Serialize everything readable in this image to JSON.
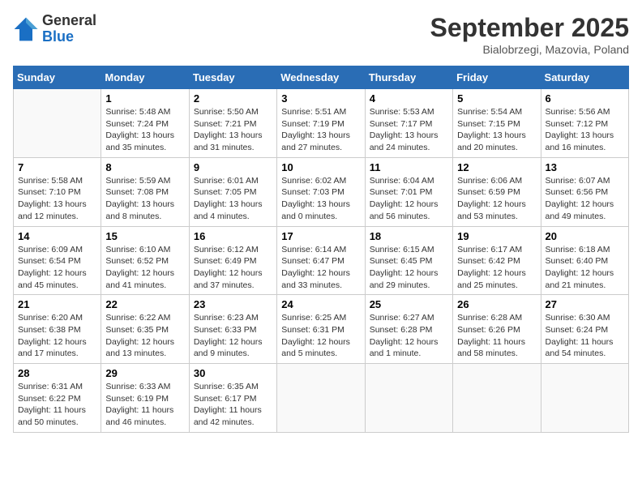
{
  "header": {
    "logo_general": "General",
    "logo_blue": "Blue",
    "month": "September 2025",
    "location": "Bialobrzegi, Mazovia, Poland"
  },
  "weekdays": [
    "Sunday",
    "Monday",
    "Tuesday",
    "Wednesday",
    "Thursday",
    "Friday",
    "Saturday"
  ],
  "weeks": [
    [
      {
        "day": null
      },
      {
        "day": 1,
        "sunrise": "5:48 AM",
        "sunset": "7:24 PM",
        "daylight": "13 hours and 35 minutes."
      },
      {
        "day": 2,
        "sunrise": "5:50 AM",
        "sunset": "7:21 PM",
        "daylight": "13 hours and 31 minutes."
      },
      {
        "day": 3,
        "sunrise": "5:51 AM",
        "sunset": "7:19 PM",
        "daylight": "13 hours and 27 minutes."
      },
      {
        "day": 4,
        "sunrise": "5:53 AM",
        "sunset": "7:17 PM",
        "daylight": "13 hours and 24 minutes."
      },
      {
        "day": 5,
        "sunrise": "5:54 AM",
        "sunset": "7:15 PM",
        "daylight": "13 hours and 20 minutes."
      },
      {
        "day": 6,
        "sunrise": "5:56 AM",
        "sunset": "7:12 PM",
        "daylight": "13 hours and 16 minutes."
      }
    ],
    [
      {
        "day": 7,
        "sunrise": "5:58 AM",
        "sunset": "7:10 PM",
        "daylight": "13 hours and 12 minutes."
      },
      {
        "day": 8,
        "sunrise": "5:59 AM",
        "sunset": "7:08 PM",
        "daylight": "13 hours and 8 minutes."
      },
      {
        "day": 9,
        "sunrise": "6:01 AM",
        "sunset": "7:05 PM",
        "daylight": "13 hours and 4 minutes."
      },
      {
        "day": 10,
        "sunrise": "6:02 AM",
        "sunset": "7:03 PM",
        "daylight": "13 hours and 0 minutes."
      },
      {
        "day": 11,
        "sunrise": "6:04 AM",
        "sunset": "7:01 PM",
        "daylight": "12 hours and 56 minutes."
      },
      {
        "day": 12,
        "sunrise": "6:06 AM",
        "sunset": "6:59 PM",
        "daylight": "12 hours and 53 minutes."
      },
      {
        "day": 13,
        "sunrise": "6:07 AM",
        "sunset": "6:56 PM",
        "daylight": "12 hours and 49 minutes."
      }
    ],
    [
      {
        "day": 14,
        "sunrise": "6:09 AM",
        "sunset": "6:54 PM",
        "daylight": "12 hours and 45 minutes."
      },
      {
        "day": 15,
        "sunrise": "6:10 AM",
        "sunset": "6:52 PM",
        "daylight": "12 hours and 41 minutes."
      },
      {
        "day": 16,
        "sunrise": "6:12 AM",
        "sunset": "6:49 PM",
        "daylight": "12 hours and 37 minutes."
      },
      {
        "day": 17,
        "sunrise": "6:14 AM",
        "sunset": "6:47 PM",
        "daylight": "12 hours and 33 minutes."
      },
      {
        "day": 18,
        "sunrise": "6:15 AM",
        "sunset": "6:45 PM",
        "daylight": "12 hours and 29 minutes."
      },
      {
        "day": 19,
        "sunrise": "6:17 AM",
        "sunset": "6:42 PM",
        "daylight": "12 hours and 25 minutes."
      },
      {
        "day": 20,
        "sunrise": "6:18 AM",
        "sunset": "6:40 PM",
        "daylight": "12 hours and 21 minutes."
      }
    ],
    [
      {
        "day": 21,
        "sunrise": "6:20 AM",
        "sunset": "6:38 PM",
        "daylight": "12 hours and 17 minutes."
      },
      {
        "day": 22,
        "sunrise": "6:22 AM",
        "sunset": "6:35 PM",
        "daylight": "12 hours and 13 minutes."
      },
      {
        "day": 23,
        "sunrise": "6:23 AM",
        "sunset": "6:33 PM",
        "daylight": "12 hours and 9 minutes."
      },
      {
        "day": 24,
        "sunrise": "6:25 AM",
        "sunset": "6:31 PM",
        "daylight": "12 hours and 5 minutes."
      },
      {
        "day": 25,
        "sunrise": "6:27 AM",
        "sunset": "6:28 PM",
        "daylight": "12 hours and 1 minute."
      },
      {
        "day": 26,
        "sunrise": "6:28 AM",
        "sunset": "6:26 PM",
        "daylight": "11 hours and 58 minutes."
      },
      {
        "day": 27,
        "sunrise": "6:30 AM",
        "sunset": "6:24 PM",
        "daylight": "11 hours and 54 minutes."
      }
    ],
    [
      {
        "day": 28,
        "sunrise": "6:31 AM",
        "sunset": "6:22 PM",
        "daylight": "11 hours and 50 minutes."
      },
      {
        "day": 29,
        "sunrise": "6:33 AM",
        "sunset": "6:19 PM",
        "daylight": "11 hours and 46 minutes."
      },
      {
        "day": 30,
        "sunrise": "6:35 AM",
        "sunset": "6:17 PM",
        "daylight": "11 hours and 42 minutes."
      },
      {
        "day": null
      },
      {
        "day": null
      },
      {
        "day": null
      },
      {
        "day": null
      }
    ]
  ]
}
